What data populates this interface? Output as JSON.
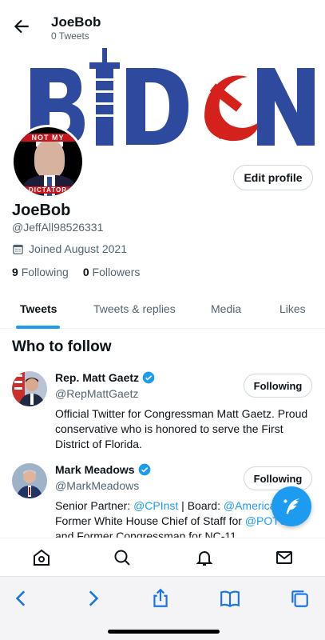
{
  "header": {
    "title": "JoeBob",
    "subtitle": "0 Tweets"
  },
  "banner": {
    "text": "BIDEN"
  },
  "avatar": {
    "caption_top": "NOT MY",
    "caption_bottom": "DICTATOR"
  },
  "profile": {
    "edit_label": "Edit profile",
    "name": "JoeBob",
    "handle": "@JeffAll98526331",
    "joined": "Joined August 2021",
    "following_count": "9",
    "following_label": "Following",
    "followers_count": "0",
    "followers_label": "Followers"
  },
  "tabs": [
    {
      "label": "Tweets",
      "active": true
    },
    {
      "label": "Tweets & replies"
    },
    {
      "label": "Media"
    },
    {
      "label": "Likes"
    }
  ],
  "who_to_follow": {
    "title": "Who to follow",
    "people": [
      {
        "name": "Rep. Matt Gaetz",
        "handle": "@RepMattGaetz",
        "button": "Following",
        "bio": "Official Twitter for Congressman Matt Gaetz. Proud conservative who is honored to serve the First District of Florida."
      },
      {
        "name": "Mark Meadows",
        "handle": "@MarkMeadows",
        "button": "Following",
        "bio_line1_prefix": "Senior Partner: ",
        "bio_line1_link1": "@CPInst",
        "bio_line1_mid": " | Board: ",
        "bio_line1_link2": "@America1st",
        "bio_line2_prefix": "Former White House Chief of Staff for ",
        "bio_line2_link": "@POTUS",
        "bio_line3": "and Former Congressman for NC-11"
      }
    ]
  },
  "colors": {
    "accent": "#1d9bf0",
    "banner_blue": "#2e4a9e",
    "banner_red": "#d4211b"
  },
  "icons": {
    "back": "arrow-left-icon",
    "verified": "verified-badge-icon",
    "compose": "compose-feather-icon",
    "nav": [
      "home-icon",
      "search-icon",
      "bell-icon",
      "mail-icon"
    ],
    "safari": [
      "safari-back-icon",
      "safari-forward-icon",
      "share-icon",
      "bookmarks-icon",
      "tabs-icon"
    ]
  }
}
